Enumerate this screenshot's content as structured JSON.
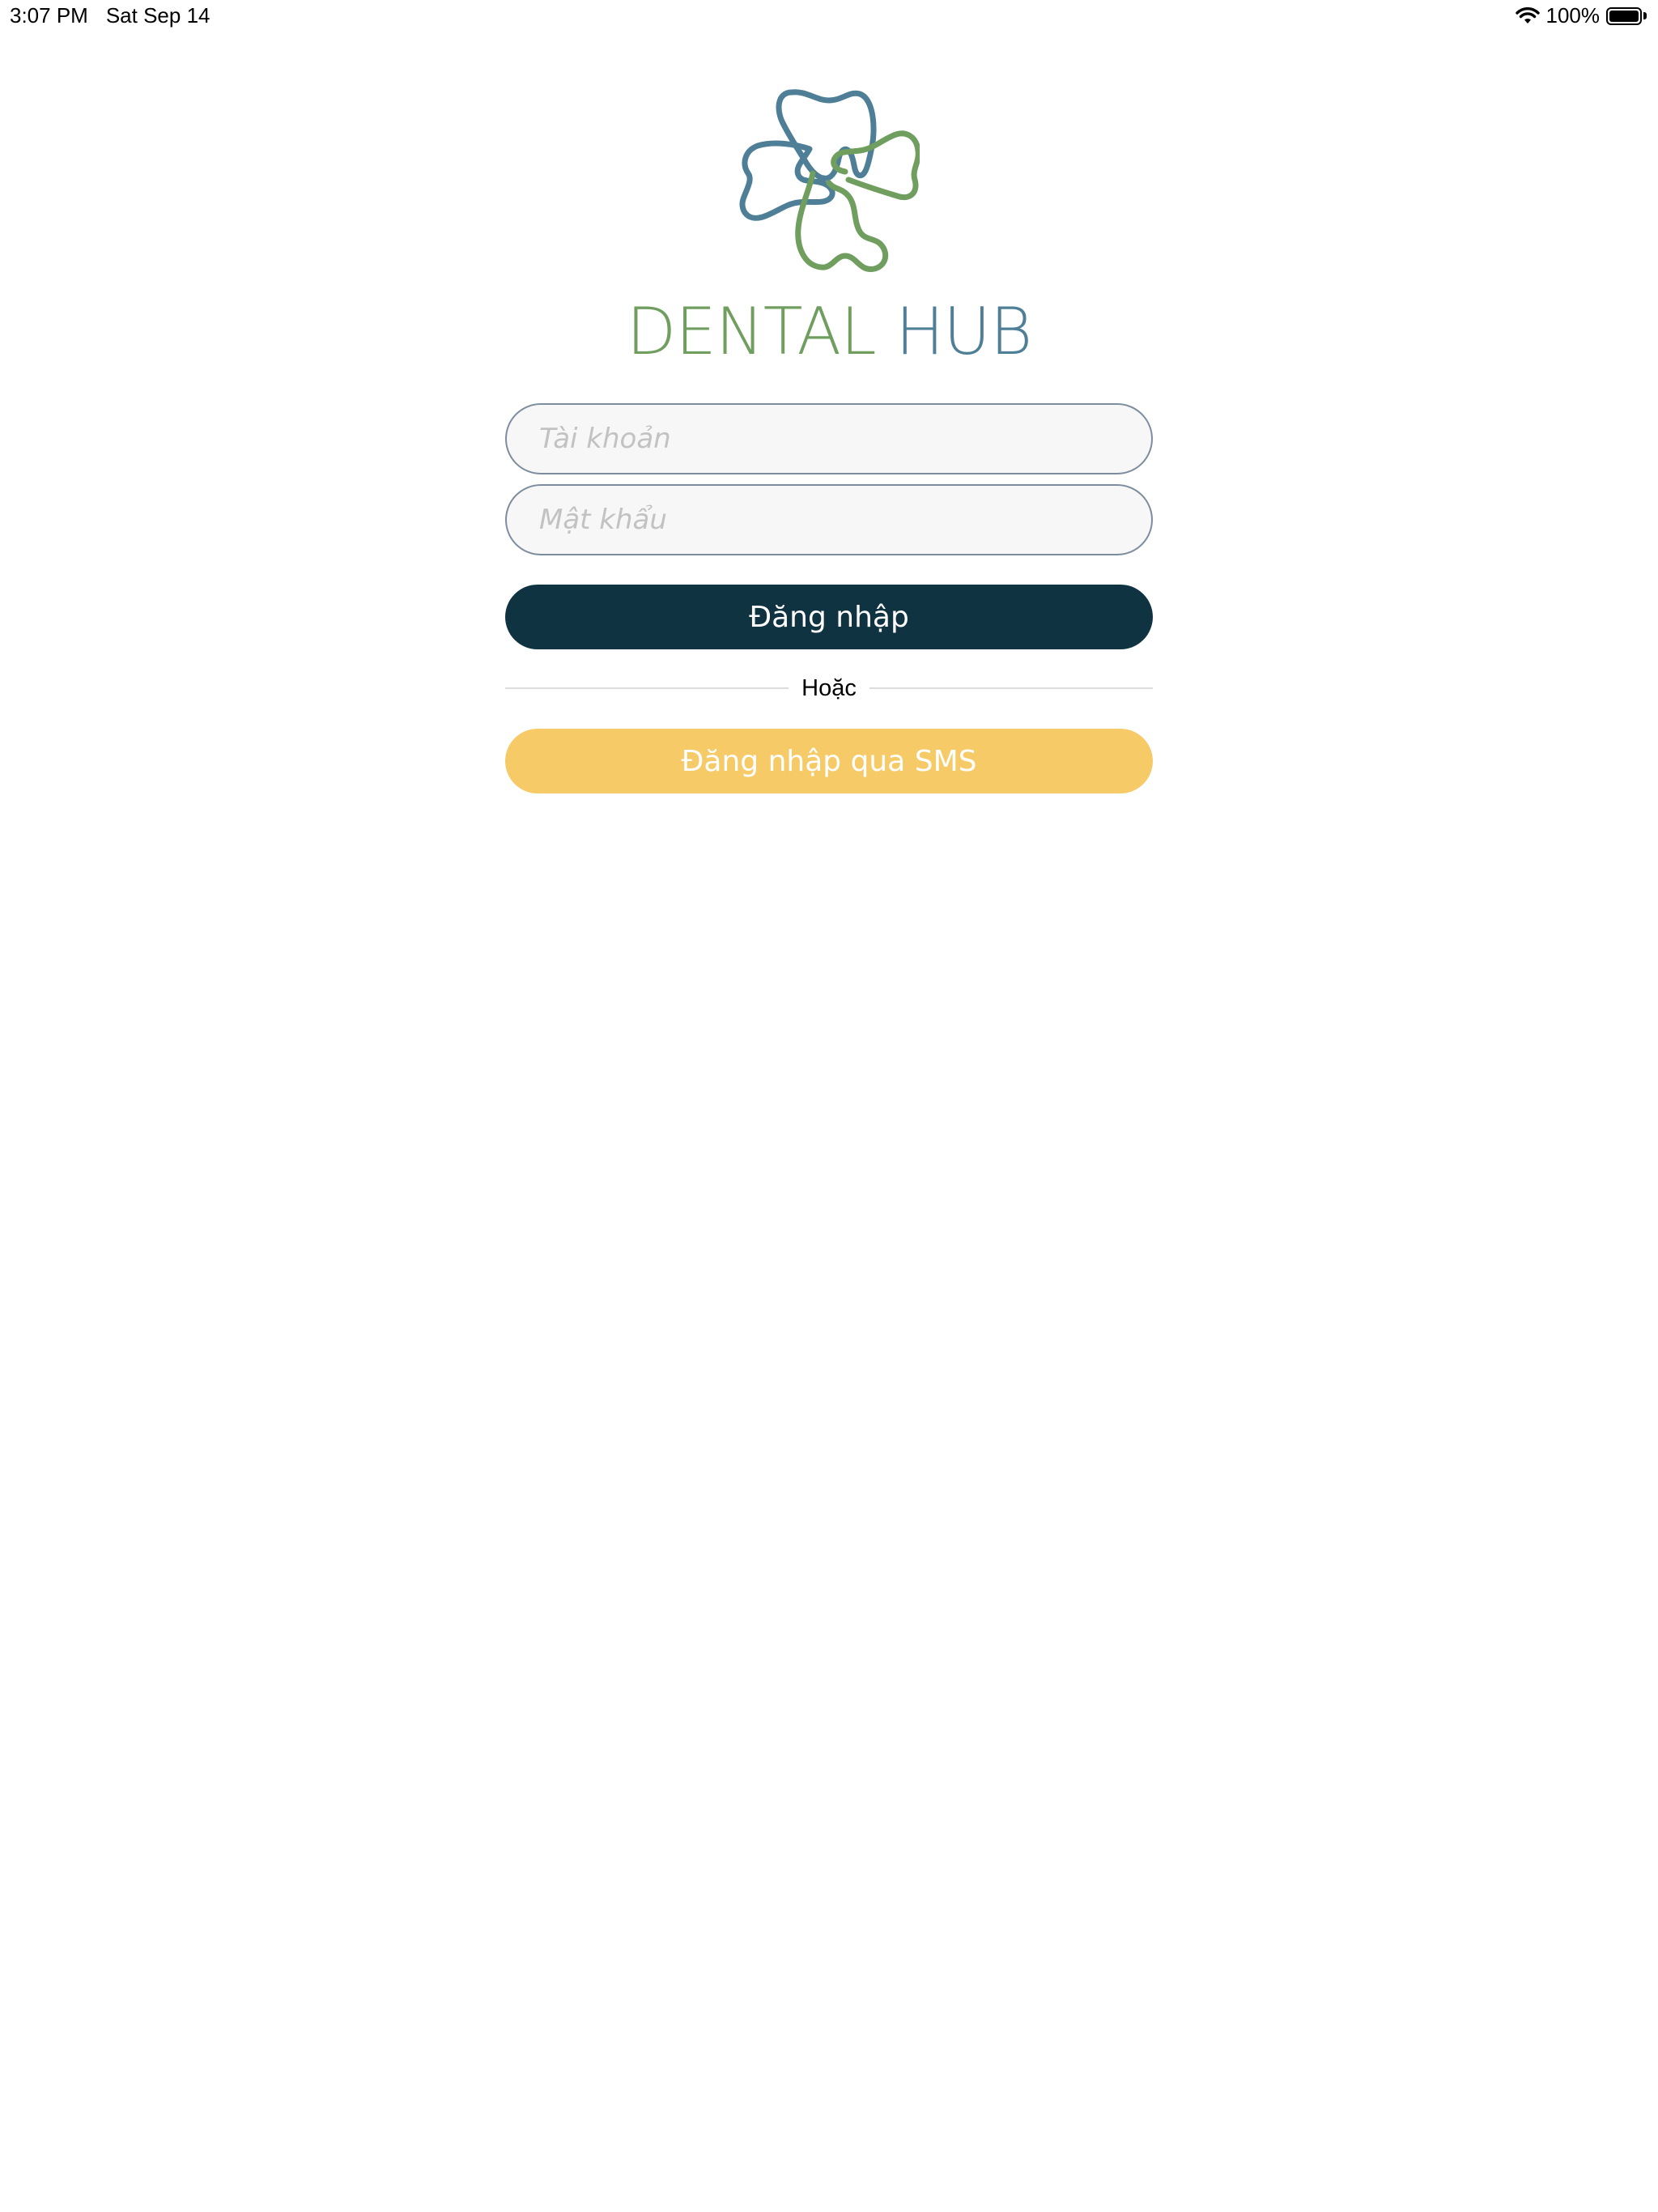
{
  "status_bar": {
    "time": "3:07 PM",
    "date": "Sat Sep 14",
    "battery": "100%",
    "battery_level": 1.0,
    "icons": [
      "wifi-icon",
      "battery-icon"
    ]
  },
  "brand": {
    "logo_icon": "tooth-clover-logo",
    "name_part1": "DENTAL",
    "name_part2": "HUB",
    "colors": {
      "green": "#6f9e5f",
      "blue": "#4e7f96"
    }
  },
  "login_form": {
    "username_placeholder": "Tài khoản",
    "password_placeholder": "Mật khẩu",
    "username_value": "",
    "password_value": "",
    "login_button": "Đăng nhập",
    "divider_text": "Hoặc",
    "sms_button": "Đăng nhập qua SMS",
    "colors": {
      "login_button_bg": "#103342",
      "sms_button_bg": "#f6cb67",
      "field_border": "#7d8d9e",
      "field_bg": "#f7f7f7"
    }
  }
}
